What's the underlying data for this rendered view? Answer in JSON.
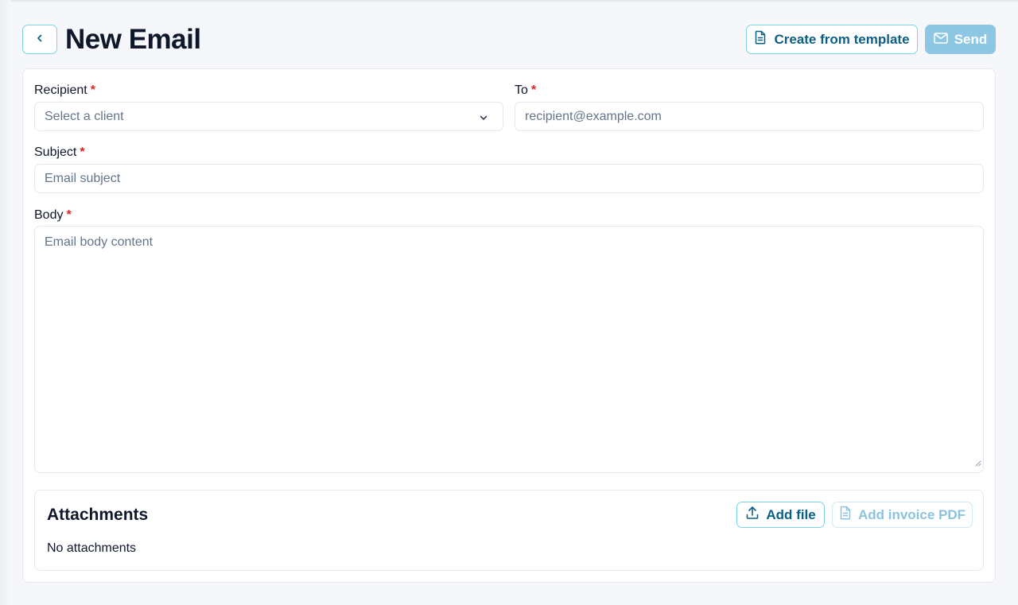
{
  "header": {
    "title": "New Email",
    "back_icon": "chevron-left-icon",
    "template_button": {
      "label": "Create from template",
      "icon": "document-icon"
    },
    "send_button": {
      "label": "Send",
      "icon": "mail-icon",
      "disabled": true
    }
  },
  "form": {
    "recipient": {
      "label": "Recipient",
      "required_mark": "*",
      "placeholder": "Select a client",
      "icon": "chevron-down-icon"
    },
    "to": {
      "label": "To",
      "required_mark": "*",
      "placeholder": "recipient@example.com"
    },
    "subject": {
      "label": "Subject",
      "required_mark": "*",
      "placeholder": "Email subject"
    },
    "body": {
      "label": "Body",
      "required_mark": "*",
      "placeholder": "Email body content"
    }
  },
  "attachments": {
    "title": "Attachments",
    "empty_text": "No attachments",
    "add_file_button": {
      "label": "Add file",
      "icon": "upload-icon"
    },
    "add_invoice_button": {
      "label": "Add invoice PDF",
      "icon": "document-icon",
      "disabled": true
    }
  },
  "colors": {
    "accent": "#0b5f86",
    "accent_border": "#7dd3e8",
    "send_disabled_bg": "#8ec7e3",
    "required": "#dc2626",
    "background": "#f5f7fa"
  }
}
